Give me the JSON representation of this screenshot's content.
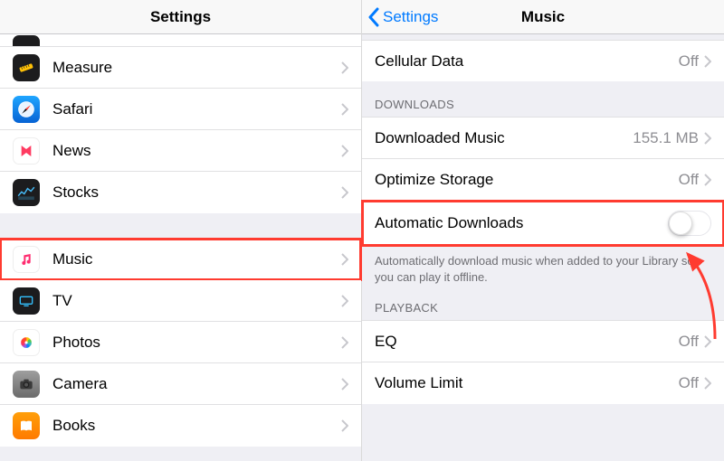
{
  "left": {
    "title": "Settings",
    "items": [
      {
        "name": "measure",
        "label": "Measure",
        "icon": "measure"
      },
      {
        "name": "safari",
        "label": "Safari",
        "icon": "safari"
      },
      {
        "name": "news",
        "label": "News",
        "icon": "news"
      },
      {
        "name": "stocks",
        "label": "Stocks",
        "icon": "stocks"
      }
    ],
    "items2": [
      {
        "name": "music",
        "label": "Music",
        "icon": "music",
        "highlighted": true
      },
      {
        "name": "tv",
        "label": "TV",
        "icon": "tv"
      },
      {
        "name": "photos",
        "label": "Photos",
        "icon": "photos"
      },
      {
        "name": "camera",
        "label": "Camera",
        "icon": "camera"
      },
      {
        "name": "books",
        "label": "Books",
        "icon": "books"
      }
    ]
  },
  "right": {
    "back": "Settings",
    "title": "Music",
    "cellular": {
      "label": "Cellular Data",
      "value": "Off"
    },
    "downloads_header": "DOWNLOADS",
    "downloaded": {
      "label": "Downloaded Music",
      "value": "155.1 MB"
    },
    "optimize": {
      "label": "Optimize Storage",
      "value": "Off"
    },
    "auto": {
      "label": "Automatic Downloads"
    },
    "auto_footer": "Automatically download music when added to your Library so you can play it offline.",
    "playback_header": "PLAYBACK",
    "eq": {
      "label": "EQ",
      "value": "Off"
    },
    "volume": {
      "label": "Volume Limit",
      "value": "Off"
    }
  }
}
